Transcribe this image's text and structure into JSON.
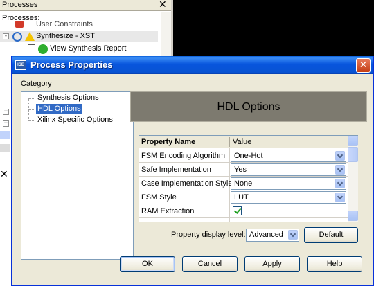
{
  "background": {
    "processes_panel": {
      "title": "Processes",
      "label": "Processes:",
      "tree": [
        {
          "label": "User Constraints"
        },
        {
          "label": "Synthesize - XST"
        },
        {
          "label": "View Synthesis Report"
        }
      ]
    }
  },
  "dialog": {
    "title": "Process Properties",
    "category_label": "Category",
    "categories": [
      {
        "label": "Synthesis Options"
      },
      {
        "label": "HDL Options"
      },
      {
        "label": "Xilinx Specific Options"
      }
    ],
    "selected_category": "HDL Options",
    "panel_heading": "HDL Options",
    "grid": {
      "col_property": "Property Name",
      "col_value": "Value",
      "rows": [
        {
          "name": "FSM Encoding Algorithm",
          "value": "One-Hot"
        },
        {
          "name": "Safe Implementation",
          "value": "Yes"
        },
        {
          "name": "Case Implementation Style",
          "value": "None"
        },
        {
          "name": "FSM Style",
          "value": "LUT"
        },
        {
          "name": "RAM Extraction",
          "value": "checked"
        }
      ]
    },
    "display_level_label": "Property display level:",
    "display_level_value": "Advanced",
    "buttons": {
      "default": "Default",
      "ok": "OK",
      "cancel": "Cancel",
      "apply": "Apply",
      "help": "Help"
    }
  },
  "colors": {
    "titlebar": "#0855dd",
    "selection": "#316ac5",
    "heading_panel": "#7d7a6f",
    "close_button": "#c43d14"
  }
}
